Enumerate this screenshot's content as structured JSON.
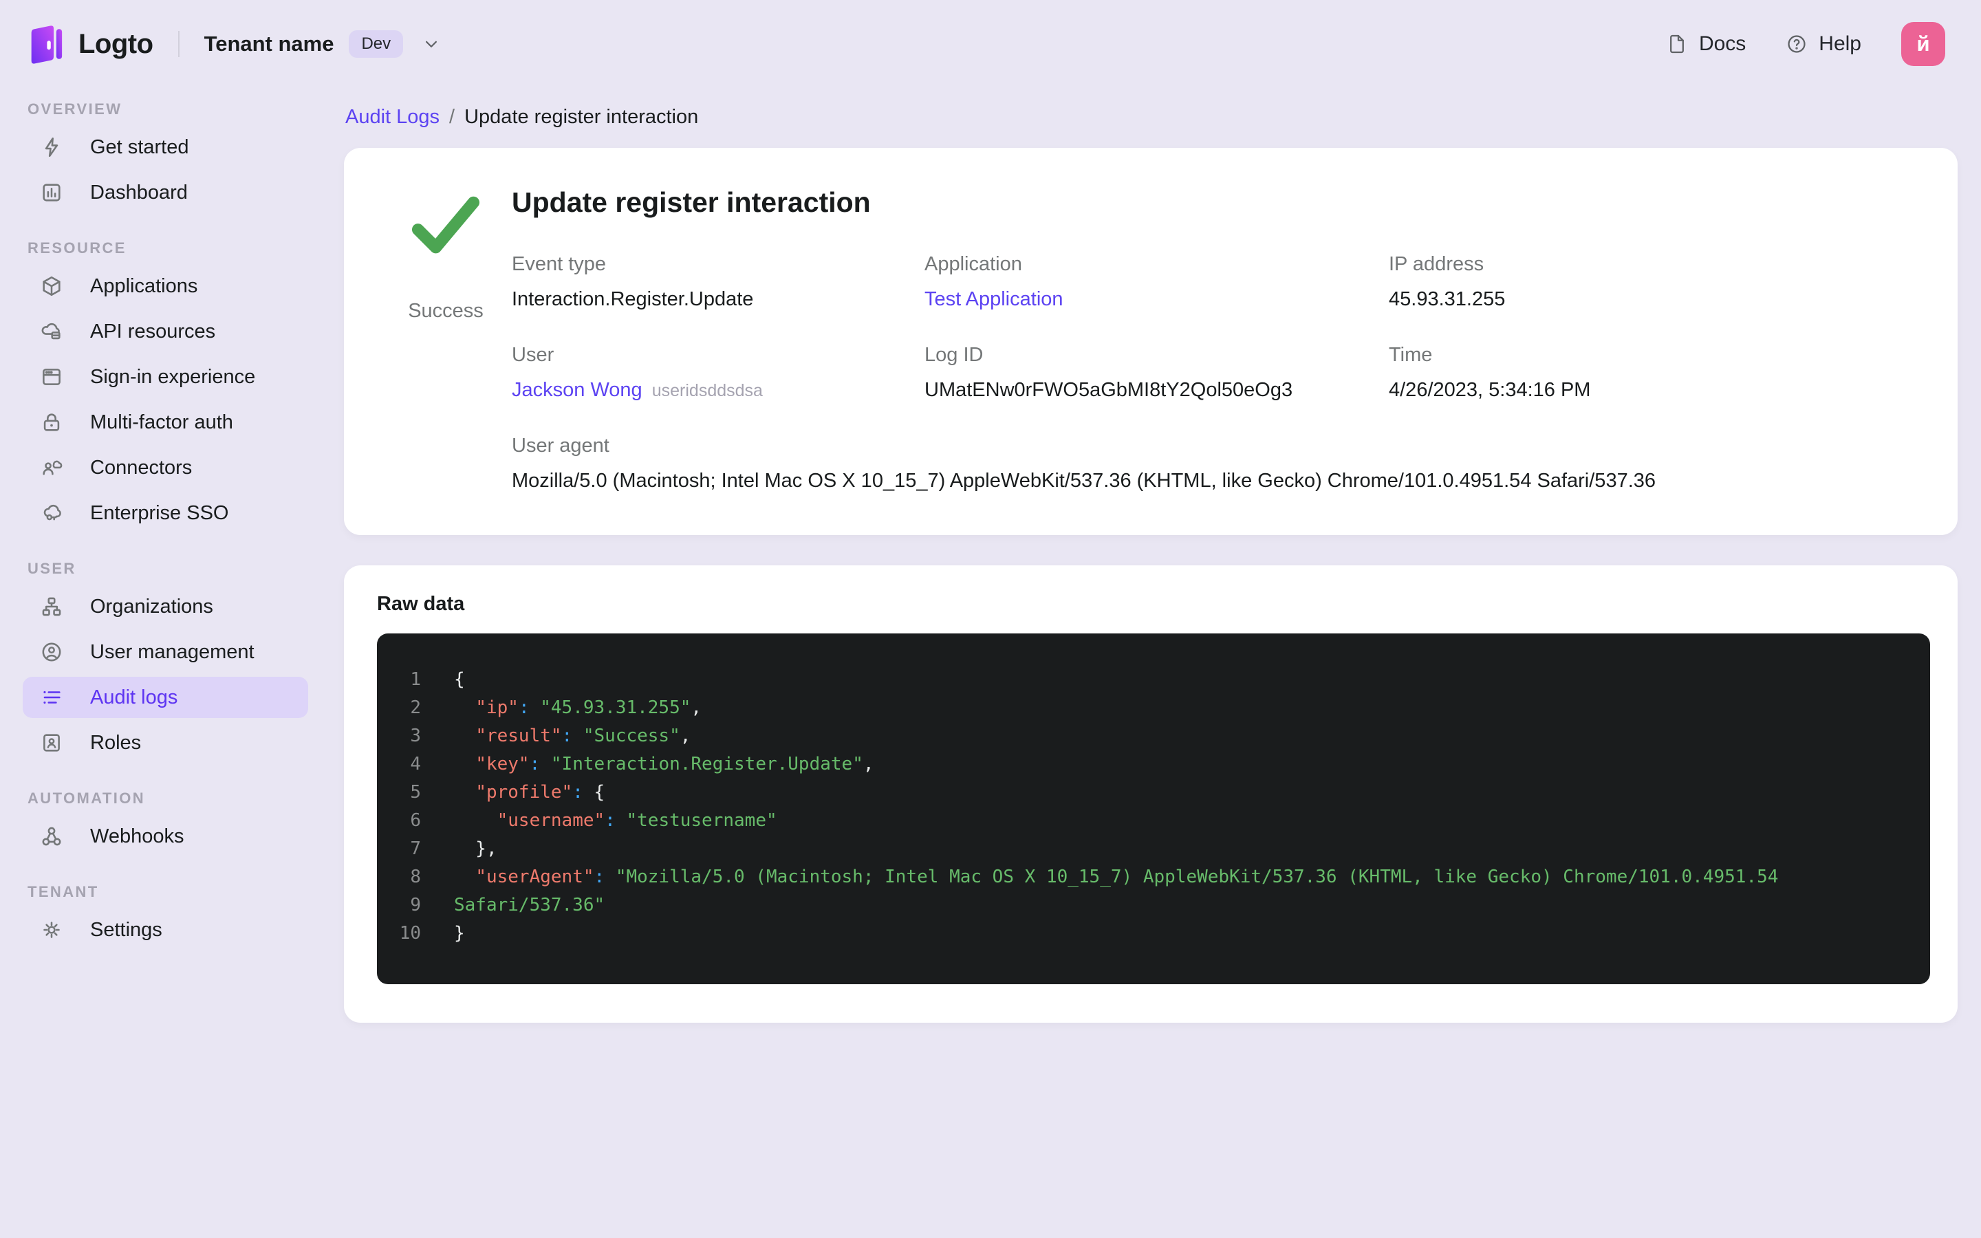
{
  "topbar": {
    "brand": "Logto",
    "tenant_name": "Tenant name",
    "tenant_badge": "Dev",
    "docs_label": "Docs",
    "help_label": "Help",
    "avatar_initial": "й"
  },
  "sidebar": {
    "sections": [
      {
        "label": "OVERVIEW",
        "items": [
          {
            "icon": "bolt",
            "label": "Get started",
            "active": false
          },
          {
            "icon": "chart",
            "label": "Dashboard",
            "active": false
          }
        ]
      },
      {
        "label": "RESOURCE",
        "items": [
          {
            "icon": "cube",
            "label": "Applications",
            "active": false
          },
          {
            "icon": "api",
            "label": "API resources",
            "active": false
          },
          {
            "icon": "browser",
            "label": "Sign-in experience",
            "active": false
          },
          {
            "icon": "lock",
            "label": "Multi-factor auth",
            "active": false
          },
          {
            "icon": "connector",
            "label": "Connectors",
            "active": false
          },
          {
            "icon": "sso",
            "label": "Enterprise SSO",
            "active": false
          }
        ]
      },
      {
        "label": "USER",
        "items": [
          {
            "icon": "org",
            "label": "Organizations",
            "active": false
          },
          {
            "icon": "user",
            "label": "User management",
            "active": false
          },
          {
            "icon": "list",
            "label": "Audit logs",
            "active": true
          },
          {
            "icon": "role",
            "label": "Roles",
            "active": false
          }
        ]
      },
      {
        "label": "AUTOMATION",
        "items": [
          {
            "icon": "webhook",
            "label": "Webhooks",
            "active": false
          }
        ]
      },
      {
        "label": "TENANT",
        "items": [
          {
            "icon": "gear",
            "label": "Settings",
            "active": false
          }
        ]
      }
    ]
  },
  "breadcrumb": {
    "parent": "Audit Logs",
    "separator": "/",
    "current": "Update register interaction"
  },
  "detail": {
    "title": "Update register interaction",
    "status": "Success",
    "fields": [
      {
        "label": "Event type",
        "value": "Interaction.Register.Update",
        "type": "text"
      },
      {
        "label": "Application",
        "value": "Test Application",
        "type": "link"
      },
      {
        "label": "IP address",
        "value": "45.93.31.255",
        "type": "text"
      },
      {
        "label": "User",
        "value": "Jackson Wong",
        "suffix": "useridsddsdsa",
        "type": "link"
      },
      {
        "label": "Log ID",
        "value": "UMatENw0rFWO5aGbMI8tY2Qol50eOg3",
        "type": "text"
      },
      {
        "label": "Time",
        "value": "4/26/2023, 5:34:16 PM",
        "type": "text"
      }
    ],
    "user_agent": {
      "label": "User agent",
      "value": "Mozilla/5.0 (Macintosh; Intel Mac OS X 10_15_7) AppleWebKit/537.36 (KHTML, like Gecko) Chrome/101.0.4951.54 Safari/537.36"
    }
  },
  "raw": {
    "title": "Raw data",
    "lines": [
      {
        "n": "1",
        "seg": [
          [
            "p",
            "{"
          ]
        ]
      },
      {
        "n": "2",
        "seg": [
          [
            "p",
            "  "
          ],
          [
            "k",
            "\"ip\""
          ],
          [
            "c",
            ":"
          ],
          [
            "p",
            " "
          ],
          [
            "s",
            "\"45.93.31.255\""
          ],
          [
            "p",
            ","
          ]
        ]
      },
      {
        "n": "3",
        "seg": [
          [
            "p",
            "  "
          ],
          [
            "k",
            "\"result\""
          ],
          [
            "c",
            ":"
          ],
          [
            "p",
            " "
          ],
          [
            "s",
            "\"Success\""
          ],
          [
            "p",
            ","
          ]
        ]
      },
      {
        "n": "4",
        "seg": [
          [
            "p",
            "  "
          ],
          [
            "k",
            "\"key\""
          ],
          [
            "c",
            ":"
          ],
          [
            "p",
            " "
          ],
          [
            "s",
            "\"Interaction.Register.Update\""
          ],
          [
            "p",
            ","
          ]
        ]
      },
      {
        "n": "5",
        "seg": [
          [
            "p",
            "  "
          ],
          [
            "k",
            "\"profile\""
          ],
          [
            "c",
            ":"
          ],
          [
            "p",
            " "
          ],
          [
            "p",
            "{"
          ]
        ]
      },
      {
        "n": "6",
        "seg": [
          [
            "p",
            "    "
          ],
          [
            "k",
            "\"username\""
          ],
          [
            "c",
            ":"
          ],
          [
            "p",
            " "
          ],
          [
            "s",
            "\"testusername\""
          ]
        ]
      },
      {
        "n": "7",
        "seg": [
          [
            "p",
            "  },"
          ]
        ]
      },
      {
        "n": "8",
        "seg": [
          [
            "p",
            "  "
          ],
          [
            "k",
            "\"userAgent\""
          ],
          [
            "c",
            ":"
          ],
          [
            "p",
            " "
          ],
          [
            "s",
            "\"Mozilla/5.0 (Macintosh; Intel Mac OS X 10_15_7) AppleWebKit/537.36 (KHTML, like Gecko) Chrome/101.0.4951.54"
          ]
        ]
      },
      {
        "n": "9",
        "seg": [
          [
            "s",
            "Safari/537.36\""
          ]
        ]
      },
      {
        "n": "10",
        "seg": [
          [
            "p",
            "}"
          ]
        ]
      }
    ]
  },
  "colors": {
    "accent_purple": "#5d34f2",
    "link_purple": "#5c43f2",
    "active_pill_bg": "#ddd4f9",
    "page_bg": "#e9e6f3",
    "card_bg": "#ffffff",
    "text_primary": "#191c1d",
    "text_secondary": "#747778",
    "section_label_gray": "#a5a3b0",
    "success_green": "#4ca552",
    "avatar_pink": "#ec6395",
    "badge_bg": "#dcd5f4",
    "code_bg": "#1a1c1d",
    "code_line_number": "#8a8c8d",
    "code_key": "#ee7a6c",
    "code_colon": "#41a7f5",
    "code_string": "#67bb6a",
    "code_punctuation": "#e9ebeb"
  }
}
